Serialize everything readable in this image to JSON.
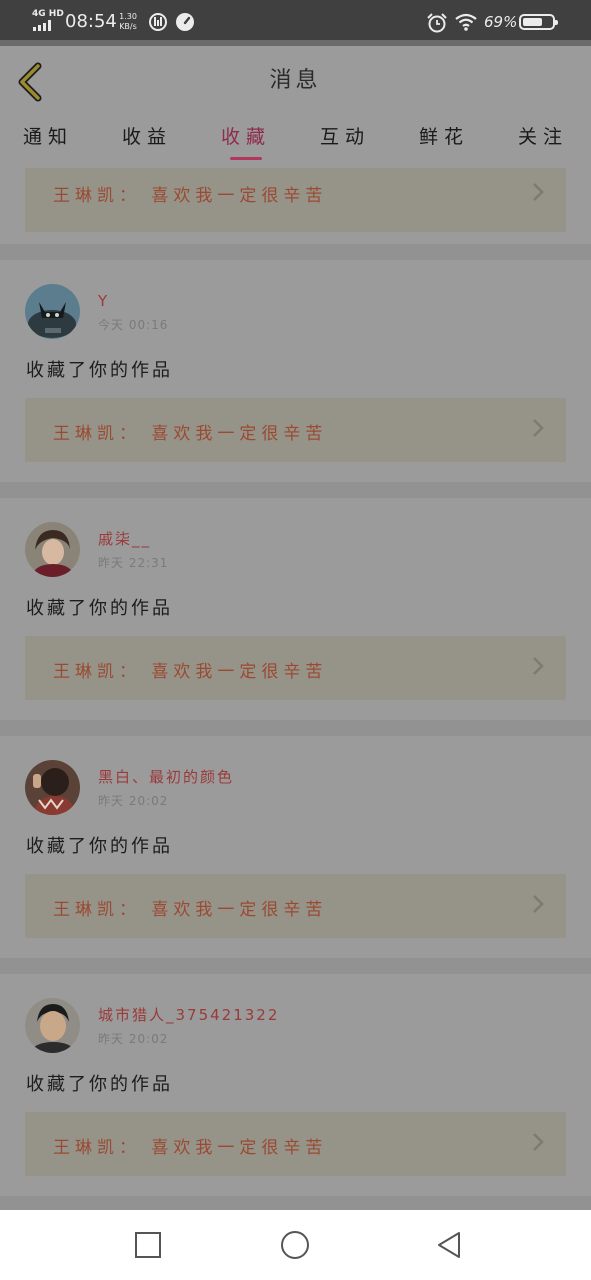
{
  "status_bar": {
    "network": "4G HD",
    "time": "08:54",
    "speed_value": "1.30",
    "speed_unit": "KB/s",
    "battery_percent": "69%",
    "battery_level": 0.69,
    "icons": [
      "signal-icon",
      "data-saver-icon",
      "speedometer-icon",
      "alarm-icon",
      "wifi-icon",
      "battery-icon"
    ]
  },
  "header": {
    "title": "消息",
    "back_icon": "chevron-left-icon",
    "accent_color": "#b4365d"
  },
  "tabs": [
    {
      "label": "通知",
      "active": false
    },
    {
      "label": "收益",
      "active": false
    },
    {
      "label": "收藏",
      "active": true
    },
    {
      "label": "互动",
      "active": false
    },
    {
      "label": "鲜花",
      "active": false
    },
    {
      "label": "关注",
      "active": false
    }
  ],
  "partial_top_card": {
    "work_title": "王琳凯： 喜欢我一定很辛苦"
  },
  "notifications": [
    {
      "username": "Y",
      "time": "今天 00:16",
      "action": "收藏了你的作品",
      "work_title": "王琳凯： 喜欢我一定很辛苦",
      "avatar": "cat-avatar"
    },
    {
      "username": "戚柒__",
      "time": "昨天 22:31",
      "action": "收藏了你的作品",
      "work_title": "王琳凯： 喜欢我一定很辛苦",
      "avatar": "person-avatar"
    },
    {
      "username": "黑白、最初的颜色",
      "time": "昨天 20:02",
      "action": "收藏了你的作品",
      "work_title": "王琳凯： 喜欢我一定很辛苦",
      "avatar": "person-avatar"
    },
    {
      "username": "城市猎人_375421322",
      "time": "昨天 20:02",
      "action": "收藏了你的作品",
      "work_title": "王琳凯： 喜欢我一定很辛苦",
      "avatar": "person-avatar"
    }
  ],
  "nav_bar": {
    "buttons": [
      "recent-apps-icon",
      "home-icon",
      "back-icon"
    ]
  }
}
